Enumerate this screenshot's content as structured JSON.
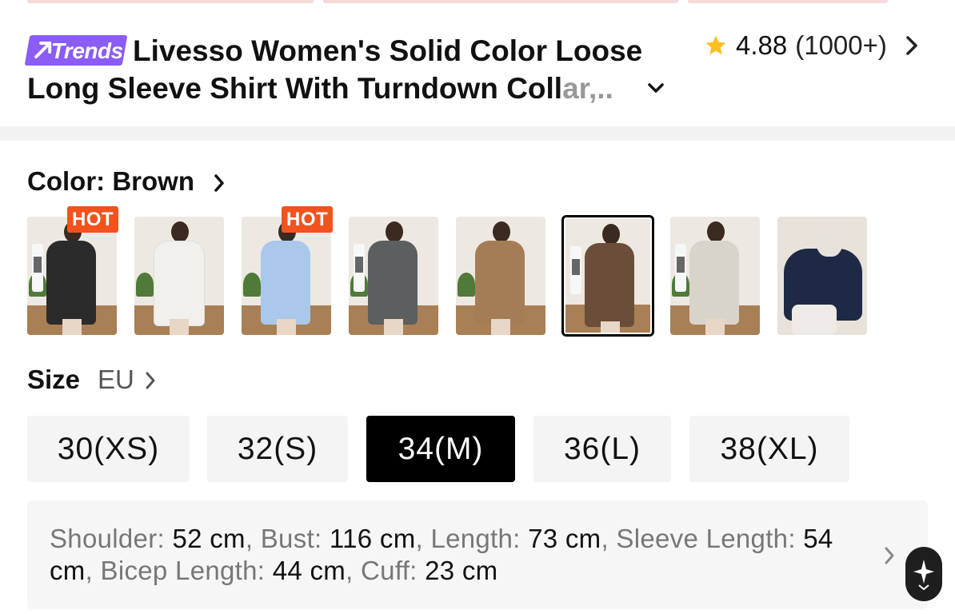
{
  "product": {
    "badge_label": "Trends",
    "title_line1": "Livesso Women's Solid Color Loose",
    "title_line2": "Long Sleeve Shirt With Turndown Coll",
    "title_fade": "ar,..",
    "rating": "4.88",
    "review_count": "(1000+)"
  },
  "color": {
    "label": "Color: Brown",
    "swatches": [
      {
        "name": "Black",
        "hot": "HOT"
      },
      {
        "name": "White",
        "hot": ""
      },
      {
        "name": "Light Blue",
        "hot": "HOT"
      },
      {
        "name": "Grey",
        "hot": ""
      },
      {
        "name": "Khaki",
        "hot": ""
      },
      {
        "name": "Brown",
        "hot": "",
        "selected": true
      },
      {
        "name": "Beige",
        "hot": ""
      },
      {
        "name": "Navy",
        "hot": ""
      }
    ],
    "swatch_colors": [
      "#2b2b2b",
      "#f1f0ec",
      "#a9c8ea",
      "#5c5f60",
      "#a47d57",
      "#6b4e3a",
      "#d9d4cb",
      "#1e2a45"
    ]
  },
  "size": {
    "label": "Size",
    "unit": "EU",
    "options": [
      "30(XS)",
      "32(S)",
      "34(M)",
      "36(L)",
      "38(XL)"
    ],
    "selected": "34(M)"
  },
  "measurements": {
    "shoulder_key": "Shoulder:",
    "shoulder_val": "52 cm",
    "bust_key": "Bust:",
    "bust_val": "116 cm",
    "length_key": "Length:",
    "length_val": "73 cm",
    "sleeve_key": "Sleeve Length:",
    "sleeve_val": "54 cm",
    "bicep_key": "Bicep Length:",
    "bicep_val": "44 cm",
    "cuff_key": "Cuff:",
    "cuff_val": "23 cm"
  },
  "colors": {
    "accent_purple": "#8b5cf6",
    "hot_orange": "#f2521e",
    "star_yellow": "#fbbf24"
  }
}
